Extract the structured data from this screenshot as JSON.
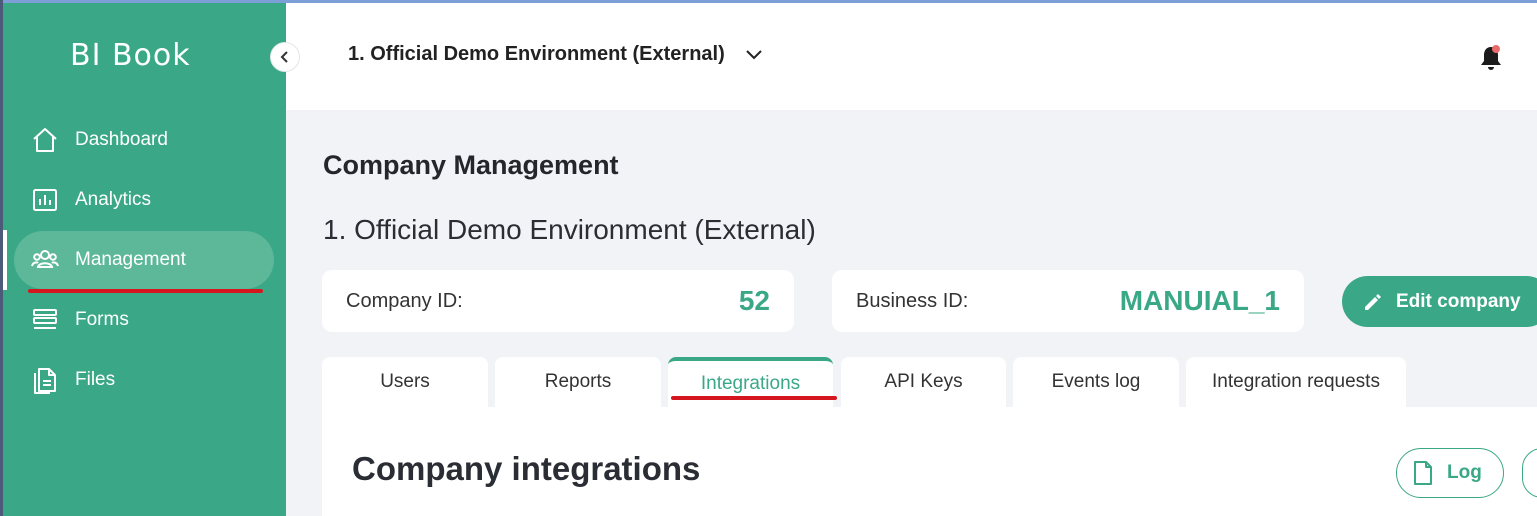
{
  "app": {
    "logo": "BI Book"
  },
  "sidebar": {
    "items": [
      {
        "label": "Dashboard",
        "icon": "home-icon"
      },
      {
        "label": "Analytics",
        "icon": "analytics-icon"
      },
      {
        "label": "Management",
        "icon": "users-icon",
        "active": true
      },
      {
        "label": "Forms",
        "icon": "forms-icon"
      },
      {
        "label": "Files",
        "icon": "files-icon"
      }
    ]
  },
  "header": {
    "environment": "1. Official Demo Environment (External)",
    "has_notification": true
  },
  "main": {
    "title": "Company Management",
    "company_name": "1. Official Demo Environment (External)",
    "company_id_label": "Company ID:",
    "company_id_value": "52",
    "business_id_label": "Business ID:",
    "business_id_value": "MANUIAL_1",
    "edit_button": "Edit company",
    "tabs": [
      {
        "label": "Users"
      },
      {
        "label": "Reports"
      },
      {
        "label": "Integrations",
        "active": true
      },
      {
        "label": "API Keys"
      },
      {
        "label": "Events log"
      },
      {
        "label": "Integration requests"
      }
    ],
    "panel_title": "Company integrations",
    "log_button": "Log"
  },
  "colors": {
    "brand": "#3aa886",
    "sidebar_active": "#5cb899",
    "annotation_red": "#d6161f",
    "notification_dot": "#e86a6a"
  }
}
